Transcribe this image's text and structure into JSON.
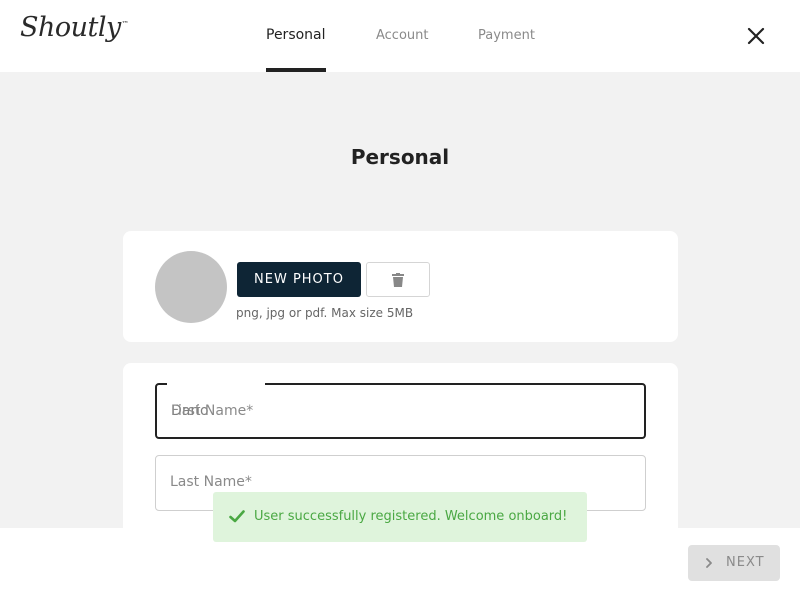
{
  "brand": {
    "logo": "Shoutly",
    "trademark": "™"
  },
  "tabs": [
    {
      "label": "Personal",
      "active": true
    },
    {
      "label": "Account",
      "active": false
    },
    {
      "label": "Payment",
      "active": false
    }
  ],
  "icons": {
    "close": "close-icon",
    "delete": "trash-icon",
    "next": "chevron-right-icon",
    "toast": "check-icon"
  },
  "page": {
    "title": "Personal"
  },
  "photo": {
    "new_photo_label": "NEW PHOTO",
    "hint": "png, jpg or pdf. Max size 5MB"
  },
  "form": {
    "first_name": {
      "placeholder": "First Name*",
      "value": "Dario"
    },
    "last_name": {
      "placeholder": "Last Name*",
      "value": ""
    }
  },
  "toast": {
    "message": "User successfully registered. Welcome onboard!"
  },
  "footer": {
    "next_label": "NEXT"
  },
  "colors": {
    "accent": "#0e2535",
    "background": "#f2f2f2",
    "toast_bg": "#dff4dc",
    "toast_text": "#4aa843"
  }
}
